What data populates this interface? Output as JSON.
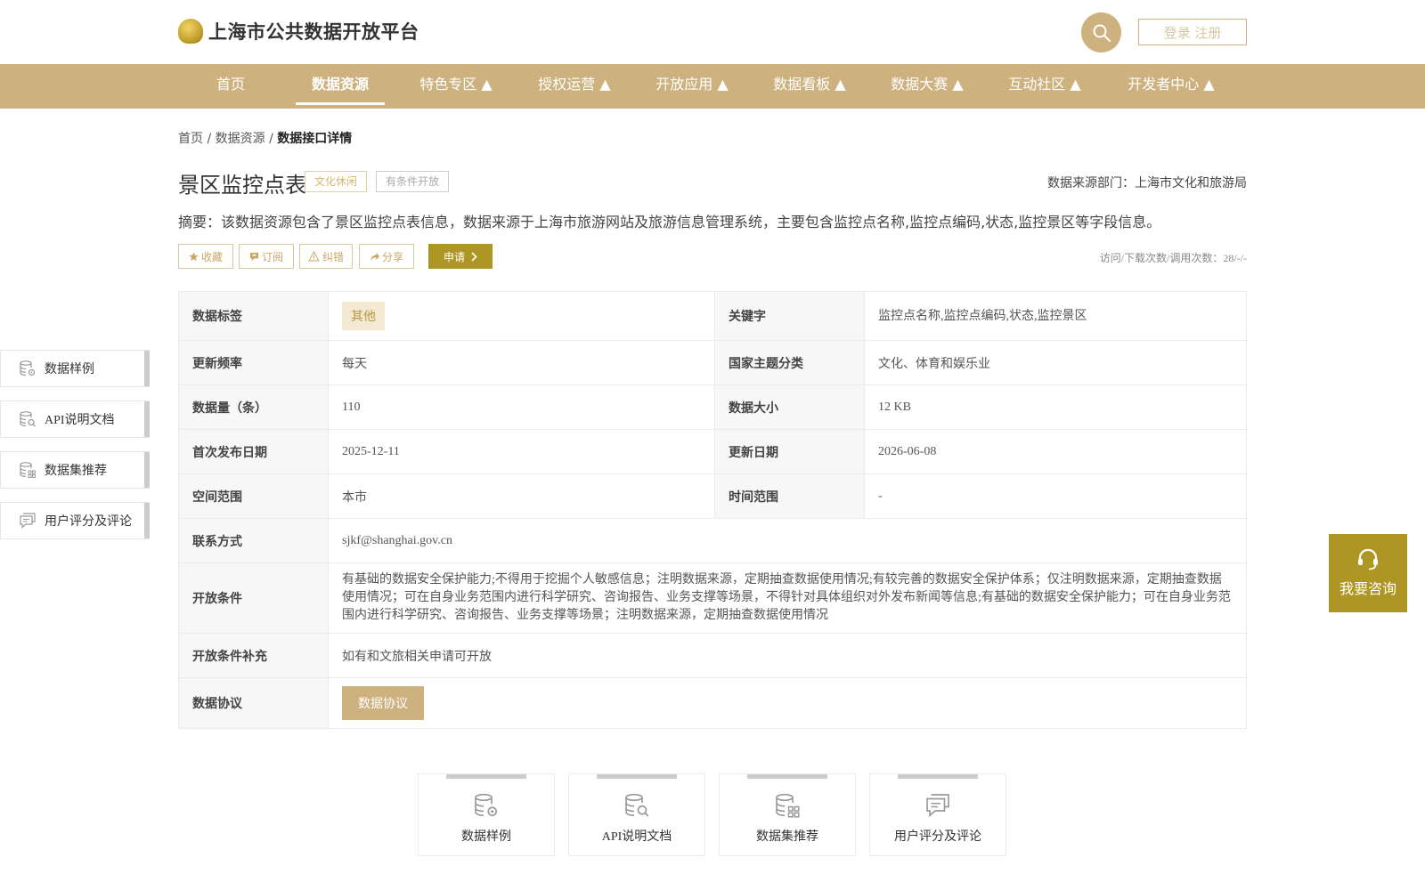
{
  "header": {
    "site_title": "上海市公共数据开放平台",
    "login_label": "登录 注册"
  },
  "nav": {
    "items": [
      {
        "label": "首页"
      },
      {
        "label": "数据资源"
      },
      {
        "label": "特色专区 ▲"
      },
      {
        "label": "授权运营 ▲"
      },
      {
        "label": "开放应用 ▲"
      },
      {
        "label": "数据看板 ▲"
      },
      {
        "label": "数据大赛 ▲"
      },
      {
        "label": "互动社区 ▲"
      },
      {
        "label": "开发者中心 ▲"
      }
    ],
    "active_index": 1
  },
  "breadcrumb": {
    "home": "首页",
    "sep1": " / ",
    "resources": "数据资源",
    "sep2": " / ",
    "current": "数据接口详情"
  },
  "dataset": {
    "title": "景区监控点表",
    "tag_category": "文化休闲",
    "tag_openness": "有条件开放",
    "source": "数据来源部门：上海市文化和旅游局",
    "summary": "摘要：该数据资源包含了景区监控点表信息，数据来源于上海市旅游网站及旅游信息管理系统，主要包含监控点名称,监控点编码,状态,监控景区等字段信息。"
  },
  "actions": {
    "favorite": "收藏",
    "subscribe": "订阅",
    "report": "纠错",
    "share": "分享",
    "apply": "申请",
    "visits": "访问/下载次数/调用次数：28/-/-"
  },
  "details": {
    "data_tag_key": "数据标签",
    "data_tag_value": "其他",
    "keywords_key": "关键字",
    "keywords_value": "监控点名称,监控点编码,状态,监控景区",
    "frequency_key": "更新频率",
    "frequency_value": "每天",
    "theme_key": "国家主题分类",
    "theme_value": "文化、体育和娱乐业",
    "count_key": "数据量（条）",
    "count_value": "110",
    "size_key": "数据大小",
    "size_value": "12 KB",
    "first_pub_key": "首次发布日期",
    "first_pub_value": "2025-12-11",
    "updated_key": "更新日期",
    "updated_value": "2026-06-08",
    "space_key": "空间范围",
    "space_value": "本市",
    "time_key": "时间范围",
    "time_value": "-",
    "contact_key": "联系方式",
    "contact_value": "sjkf@shanghai.gov.cn",
    "conditions_key": "开放条件",
    "conditions_value": "有基础的数据安全保护能力;不得用于挖掘个人敏感信息；注明数据来源，定期抽查数据使用情况;有较完善的数据安全保护体系；仅注明数据来源，定期抽查数据使用情况；可在自身业务范围内进行科学研究、咨询报告、业务支撑等场景，不得针对具体组织对外发布新闻等信息;有基础的数据安全保护能力；可在自身业务范围内进行科学研究、咨询报告、业务支撑等场景；注明数据来源，定期抽查数据使用情况",
    "cond_extra_key": "开放条件补充",
    "cond_extra_value": "如有和文旅相关申请可开放",
    "protocol_key": "数据协议",
    "protocol_button": "数据协议"
  },
  "side_nav": {
    "items": [
      {
        "label": "数据样例",
        "icon": "database-gear-icon"
      },
      {
        "label": "API说明文档",
        "icon": "document-search-icon"
      },
      {
        "label": "数据集推荐",
        "icon": "database-grid-icon"
      },
      {
        "label": "用户评分及评论",
        "icon": "comment-icon"
      }
    ]
  },
  "consult": {
    "label": "我要咨询",
    "icon": "headset-icon"
  },
  "bottom_cards": {
    "items": [
      {
        "label": "数据样例",
        "icon": "database-gear-icon"
      },
      {
        "label": "API说明文档",
        "icon": "document-search-icon"
      },
      {
        "label": "数据集推荐",
        "icon": "database-grid-icon"
      },
      {
        "label": "用户评分及评论",
        "icon": "comment-icon"
      }
    ]
  },
  "colors": {
    "brand": "#cdb27f",
    "accent": "#ad9624"
  }
}
